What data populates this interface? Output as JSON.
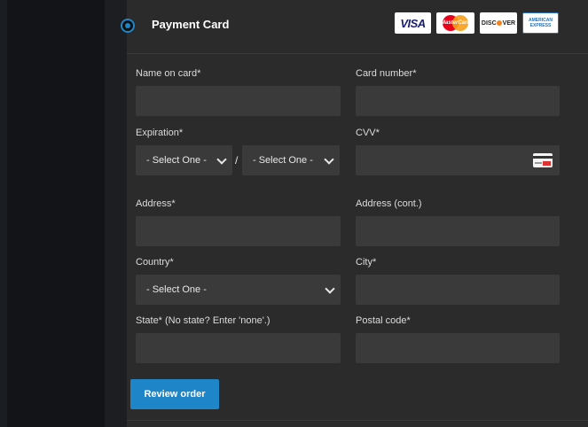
{
  "payment": {
    "title": "Payment Card",
    "cards": {
      "visa": "VISA",
      "mastercard": "MasterCard",
      "discover_pre": "DISC",
      "discover_post": "VER",
      "amex_line1": "AMERICAN",
      "amex_line2": "EXPRESS"
    },
    "accent_color": "#1e86c8"
  },
  "form": {
    "name_label": "Name on card*",
    "card_number_label": "Card number*",
    "expiration_label": "Expiration*",
    "expiration_month": "- Select One -",
    "expiration_separator": "/",
    "expiration_year": "- Select One -",
    "cvv_label": "CVV*",
    "address_label": "Address*",
    "address2_label": "Address (cont.)",
    "country_label": "Country*",
    "country_value": "- Select One -",
    "city_label": "City*",
    "state_label": "State* (No state? Enter 'none'.)",
    "postal_label": "Postal code*",
    "submit_label": "Review order"
  }
}
